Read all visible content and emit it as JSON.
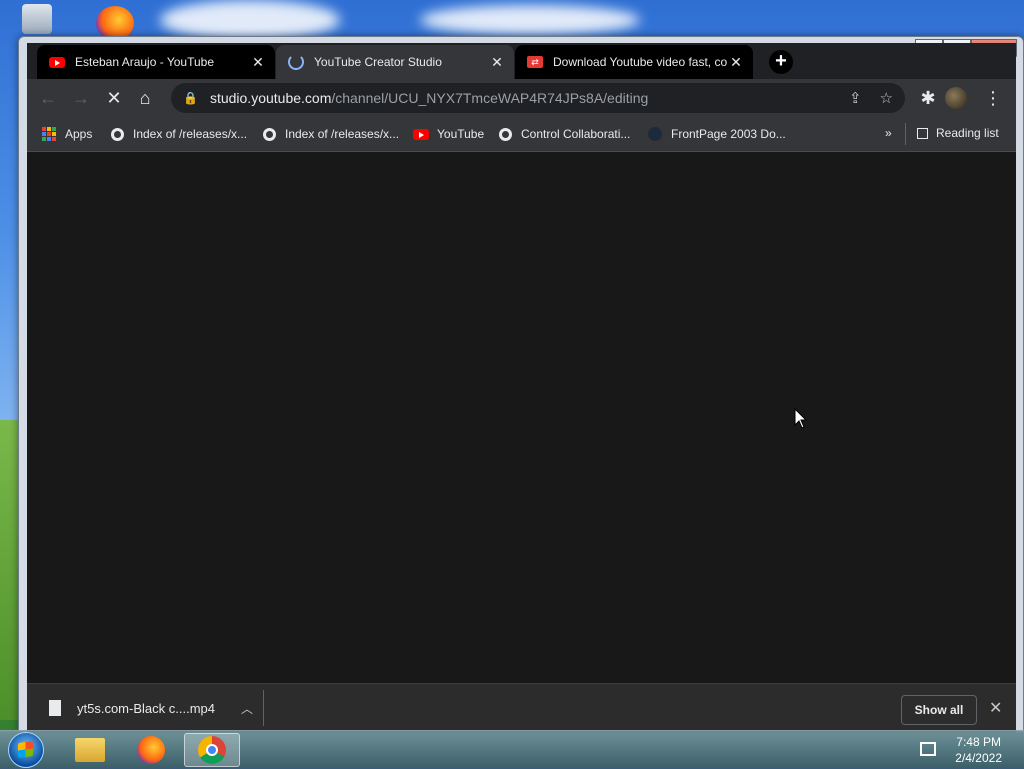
{
  "browser": {
    "tabs": [
      {
        "title": "Esteban Araujo - YouTube",
        "favicon": "youtube-icon",
        "active": false
      },
      {
        "title": "YouTube Creator Studio",
        "favicon": "loading-spinner-icon",
        "active": true
      },
      {
        "title": "Download Youtube video fast, co",
        "favicon": "download-site-icon",
        "active": false
      }
    ],
    "address": {
      "host": "studio.youtube.com",
      "path": "/channel/UCU_NYX7TmceWAP4R74JPs8A/editing"
    },
    "bookmarks": [
      {
        "label": "Apps",
        "icon": "apps-grid-icon"
      },
      {
        "label": "Index of /releases/x...",
        "icon": "globe-icon"
      },
      {
        "label": "Index of /releases/x...",
        "icon": "globe-icon"
      },
      {
        "label": "YouTube",
        "icon": "youtube-icon"
      },
      {
        "label": "Control Collaborati...",
        "icon": "globe-icon"
      },
      {
        "label": "FrontPage 2003 Do...",
        "icon": "site-icon"
      }
    ],
    "bookmarks_overflow": "»",
    "reading_list": "Reading list"
  },
  "downloads": {
    "file": "yt5s.com-Black c....mp4",
    "show_all": "Show all"
  },
  "taskbar": {
    "time": "7:48 PM",
    "date": "2/4/2022"
  },
  "colors": {
    "chrome_dark": "#202124",
    "toolbar": "#35363a",
    "content": "#181818",
    "accent_blue": "#8ab4f8"
  }
}
